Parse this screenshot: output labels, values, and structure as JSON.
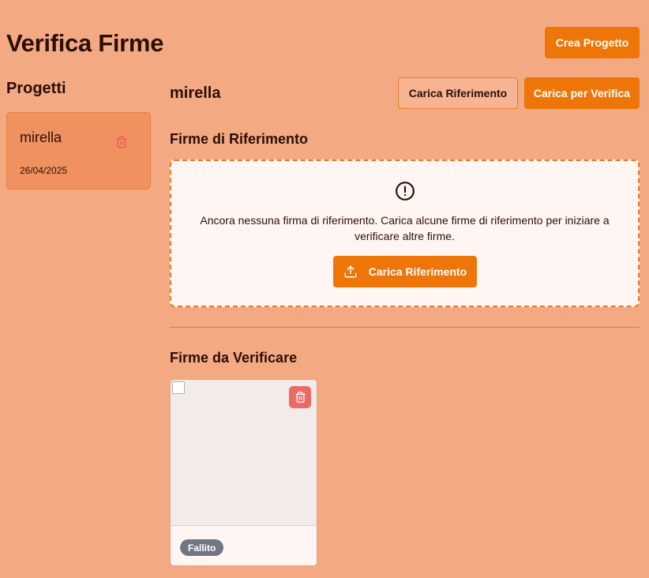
{
  "app": {
    "title": "Verifica Firme",
    "create_project_label": "Crea Progetto"
  },
  "sidebar": {
    "title": "Progetti",
    "projects": [
      {
        "name": "mirella",
        "date": "26/04/2025"
      }
    ]
  },
  "main": {
    "project_title": "mirella",
    "upload_reference_label": "Carica Riferimento",
    "upload_verify_label": "Carica per Verifica",
    "reference_section": {
      "title": "Firme di Riferimento",
      "empty_message": "Ancora nessuna firma di riferimento. Carica alcune firme di riferimento per iniziare a verificare altre firme.",
      "upload_label": "Carica Riferimento"
    },
    "verify_section": {
      "title": "Firme da Verificare",
      "signatures": [
        {
          "status": "Fallito"
        }
      ]
    }
  },
  "icons": {
    "trash": "trash-icon",
    "alert": "alert-circle-icon",
    "upload": "upload-icon",
    "broken_image": "broken-image-icon"
  },
  "colors": {
    "background": "#f3a982",
    "accent": "#ee7608",
    "danger": "#ec6a64",
    "status_failed": "#707684"
  }
}
